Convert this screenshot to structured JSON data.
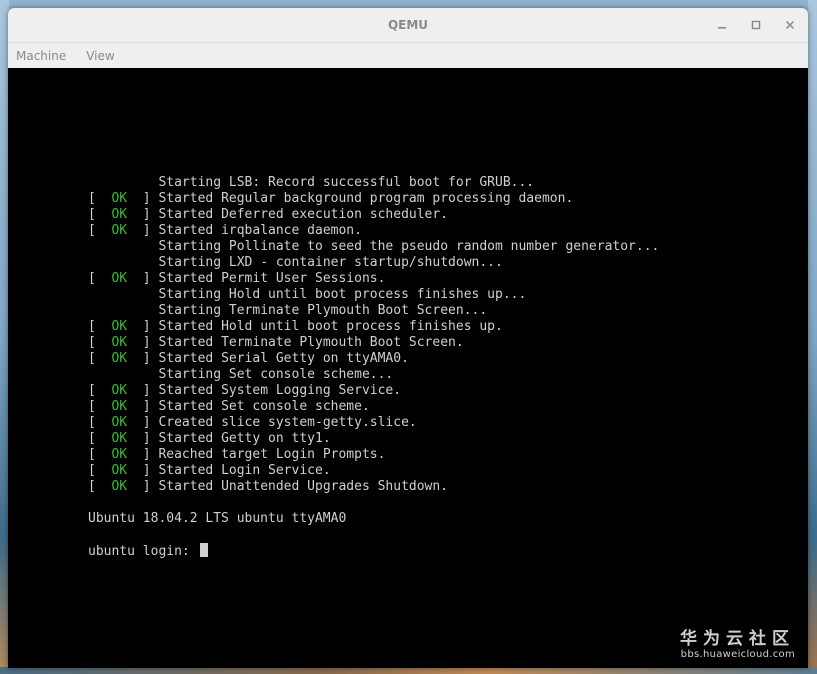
{
  "window": {
    "title": "QEMU",
    "controls": {
      "minimize_icon": "minimize-icon",
      "maximize_icon": "maximize-icon",
      "close_icon": "close-icon"
    }
  },
  "menubar": {
    "items": [
      {
        "label": "Machine"
      },
      {
        "label": "View"
      }
    ]
  },
  "console": {
    "lines": [
      {
        "status": "",
        "text": "Starting LSB: Record successful boot for GRUB..."
      },
      {
        "status": "OK",
        "text": "Started Regular background program processing daemon."
      },
      {
        "status": "OK",
        "text": "Started Deferred execution scheduler."
      },
      {
        "status": "OK",
        "text": "Started irqbalance daemon."
      },
      {
        "status": "",
        "text": "Starting Pollinate to seed the pseudo random number generator..."
      },
      {
        "status": "",
        "text": "Starting LXD - container startup/shutdown..."
      },
      {
        "status": "OK",
        "text": "Started Permit User Sessions."
      },
      {
        "status": "",
        "text": "Starting Hold until boot process finishes up..."
      },
      {
        "status": "",
        "text": "Starting Terminate Plymouth Boot Screen..."
      },
      {
        "status": "OK",
        "text": "Started Hold until boot process finishes up."
      },
      {
        "status": "OK",
        "text": "Started Terminate Plymouth Boot Screen."
      },
      {
        "status": "OK",
        "text": "Started Serial Getty on ttyAMA0."
      },
      {
        "status": "",
        "text": "Starting Set console scheme..."
      },
      {
        "status": "OK",
        "text": "Started System Logging Service."
      },
      {
        "status": "OK",
        "text": "Started Set console scheme."
      },
      {
        "status": "OK",
        "text": "Created slice system-getty.slice."
      },
      {
        "status": "OK",
        "text": "Started Getty on tty1."
      },
      {
        "status": "OK",
        "text": "Reached target Login Prompts."
      },
      {
        "status": "OK",
        "text": "Started Login Service."
      },
      {
        "status": "OK",
        "text": "Started Unattended Upgrades Shutdown."
      }
    ],
    "banner": "Ubuntu 18.04.2 LTS ubuntu ttyAMA0",
    "login_prompt": "ubuntu login: "
  },
  "watermark": {
    "brand": "华为云社区",
    "url": "bbs.huaweicloud.com"
  },
  "colors": {
    "ok_green": "#2fbf2f",
    "console_text": "#cfcfcf",
    "console_bg": "#000000",
    "titlebar_bg": "#efefef"
  }
}
